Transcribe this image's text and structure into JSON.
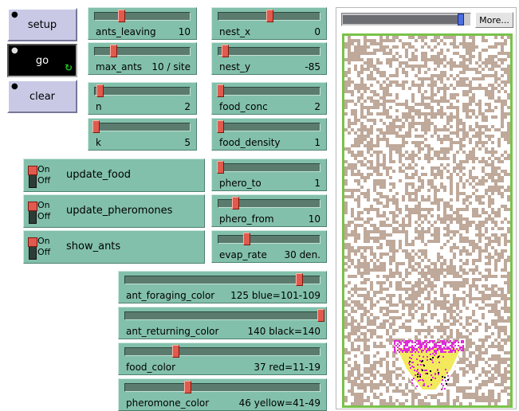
{
  "buttons": {
    "setup": {
      "label": "setup",
      "corner": "●"
    },
    "go": {
      "label": "go",
      "corner": "●",
      "forever": "↻"
    },
    "clear": {
      "label": "clear",
      "corner": "●"
    }
  },
  "sliders": [
    {
      "id": "ants_leaving",
      "label": "ants_leaving",
      "value": "10",
      "fraction": 0.28
    },
    {
      "id": "max_ants",
      "label": "max_ants",
      "value": "10 / site",
      "fraction": 0.2
    },
    {
      "id": "n",
      "label": "n",
      "value": "2",
      "fraction": 0.06
    },
    {
      "id": "k",
      "label": "k",
      "value": "5",
      "fraction": 0.02
    },
    {
      "id": "nest_x",
      "label": "nest_x",
      "value": "0",
      "fraction": 0.5
    },
    {
      "id": "nest_y",
      "label": "nest_y",
      "value": "-85",
      "fraction": 0.07
    },
    {
      "id": "food_conc",
      "label": "food_conc",
      "value": "2",
      "fraction": 0.02
    },
    {
      "id": "food_density",
      "label": "food_density",
      "value": "1",
      "fraction": 0.02
    },
    {
      "id": "phero_to",
      "label": "phero_to",
      "value": "1",
      "fraction": 0.02
    },
    {
      "id": "phero_from",
      "label": "phero_from",
      "value": "10",
      "fraction": 0.17
    },
    {
      "id": "evap_rate",
      "label": "evap_rate",
      "value": "30 den.",
      "fraction": 0.28
    },
    {
      "id": "ant_foraging_color",
      "label": "ant_foraging_color",
      "value": "125 blue=101-109",
      "fraction": 0.89
    },
    {
      "id": "ant_returning_color",
      "label": "ant_returning_color",
      "value": "140 black=140",
      "fraction": 1.0
    },
    {
      "id": "food_color",
      "label": "food_color",
      "value": "37 red=11-19",
      "fraction": 0.26
    },
    {
      "id": "pheromone_color",
      "label": "pheromone_color",
      "value": "46 yellow=41-49",
      "fraction": 0.32
    }
  ],
  "switches": [
    {
      "id": "update_food",
      "name": "update_food",
      "on": "On",
      "off": "Off",
      "state": "on"
    },
    {
      "id": "update_pheromones",
      "name": "update_pheromones",
      "on": "On",
      "off": "Off",
      "state": "on"
    },
    {
      "id": "show_ants",
      "name": "show_ants",
      "on": "On",
      "off": "Off",
      "state": "on"
    }
  ],
  "view": {
    "more_label": "More...",
    "speed": 0.93,
    "colors": {
      "food": "#bfa99a",
      "background": "#ffffff",
      "border": "#7ac24a",
      "pheromone": "#f2ea5c",
      "ants_foraging": "#e02ad8",
      "ants_returning": "#000000"
    }
  },
  "colors": {
    "button_bg": "#c9c9e6",
    "button_active_bg": "#000000",
    "widget_bg": "#82c0ab",
    "thumb": "#e05a4e"
  }
}
